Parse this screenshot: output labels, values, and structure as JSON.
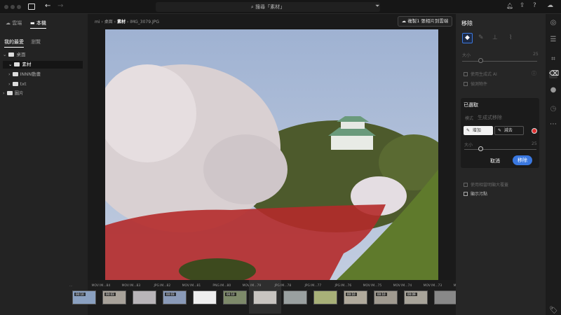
{
  "topbar": {
    "search_placeholder": "搜尋「素材」",
    "icons": [
      "sidebar-toggle-icon",
      "back-arrow-icon",
      "forward-arrow-icon",
      "search-icon",
      "filter-icon",
      "bell-icon",
      "share-icon",
      "help-icon",
      "cloud-icon"
    ]
  },
  "left": {
    "tabs": [
      "雲端",
      "本機"
    ],
    "subtabs": [
      "我的最愛",
      "瀏覽"
    ],
    "tree": [
      {
        "label": "桌面",
        "expanded": true
      },
      {
        "label": "素材",
        "expanded": true,
        "selected": true
      },
      {
        "label": "INNN動畫"
      },
      {
        "label": "txt"
      },
      {
        "label": "圖片"
      }
    ]
  },
  "breadcrumb": [
    "mi",
    "桌面",
    "素材",
    "IMG_3079.JPG"
  ],
  "cloud_button": "複製1 張相片到雲端",
  "filmstrip": [
    {
      "name": "...",
      "type": "MOV",
      "dur": "00:10"
    },
    {
      "name": "IM...84",
      "type": "MOV",
      "dur": "00:03"
    },
    {
      "name": "IM...83",
      "type": "JPG"
    },
    {
      "name": "IM...82",
      "type": "MOV",
      "dur": "00:03"
    },
    {
      "name": "IM...81",
      "type": "PNG"
    },
    {
      "name": "IM...80",
      "type": "MOV",
      "dur": "00:10"
    },
    {
      "name": "IM...79",
      "type": "JPG",
      "selected": true
    },
    {
      "name": "IM...78",
      "type": "JPG"
    },
    {
      "name": "IM...77",
      "type": "JPG"
    },
    {
      "name": "IM...76",
      "type": "MOV",
      "dur": "00:10"
    },
    {
      "name": "IM...75",
      "type": "MOV",
      "dur": "00:10"
    },
    {
      "name": "IM...74",
      "type": "MOV",
      "dur": "00:09"
    },
    {
      "name": "IM...73",
      "type": "MOV"
    }
  ],
  "right": {
    "title": "移除",
    "size_label": "大小",
    "size_value": "25",
    "opt1": "使用生成式 AI",
    "opt2": "偵測物件",
    "selected_title": "已選取",
    "mode_label": "模式",
    "mode_value": "生成式移除",
    "add": "增加",
    "subtract": "減去",
    "brush_size_label": "大小",
    "brush_size_value": "25",
    "brush_size_fraction": 0.2,
    "cancel": "取消",
    "remove": "移除",
    "opt3": "使用相當明顯大覆蓋",
    "opt4": "顯示污點",
    "accent": "#3a78e0",
    "mask_color": "#e03030"
  }
}
